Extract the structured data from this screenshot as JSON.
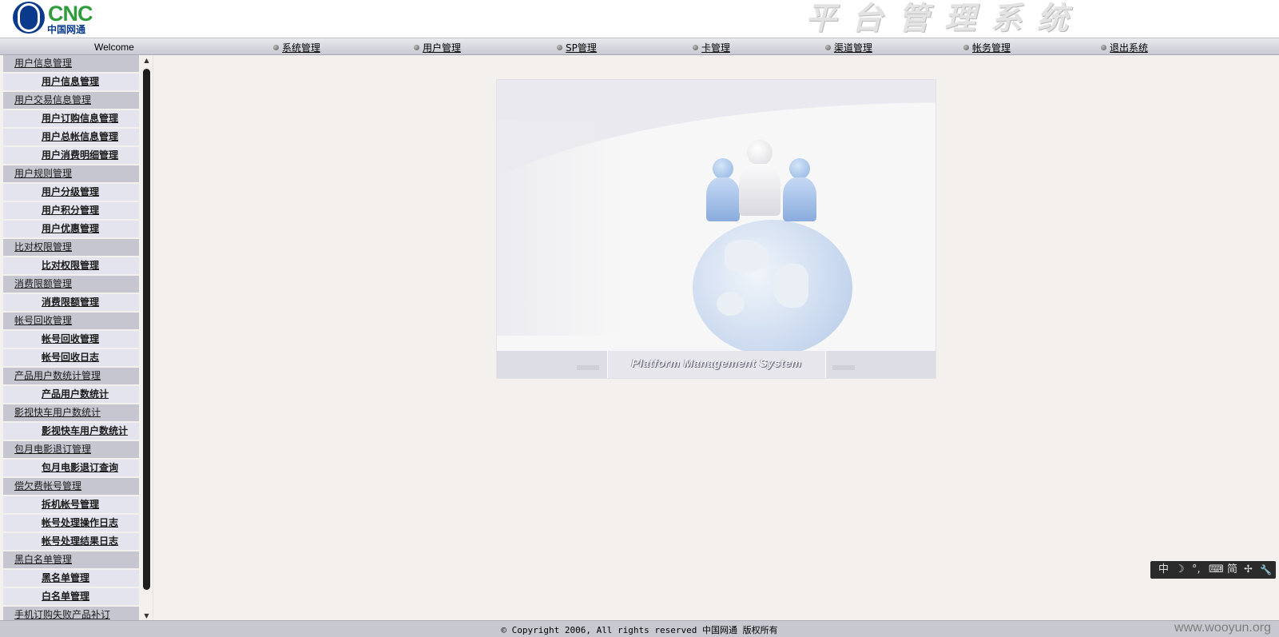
{
  "header": {
    "logo_text": "CNC",
    "logo_subtitle": "中国网通",
    "system_title": "平台管理系统"
  },
  "nav": {
    "welcome": "Welcome",
    "items": [
      {
        "label": "系统管理"
      },
      {
        "label": "用户管理"
      },
      {
        "label": "SP管理"
      },
      {
        "label": "卡管理"
      },
      {
        "label": "渠道管理"
      },
      {
        "label": "帐务管理"
      },
      {
        "label": "退出系统"
      }
    ]
  },
  "sidebar": {
    "items": [
      {
        "label": "用户信息管理",
        "type": "group"
      },
      {
        "label": "用户信息管理",
        "type": "sub"
      },
      {
        "label": "用户交易信息管理",
        "type": "group"
      },
      {
        "label": "用户订购信息管理",
        "type": "sub"
      },
      {
        "label": "用户总帐信息管理",
        "type": "sub"
      },
      {
        "label": "用户消费明细管理",
        "type": "sub"
      },
      {
        "label": "用户规则管理",
        "type": "group"
      },
      {
        "label": "用户分级管理",
        "type": "sub"
      },
      {
        "label": "用户积分管理",
        "type": "sub"
      },
      {
        "label": "用户优惠管理",
        "type": "sub"
      },
      {
        "label": "比对权限管理",
        "type": "group"
      },
      {
        "label": "比对权限管理",
        "type": "sub"
      },
      {
        "label": "消费限额管理",
        "type": "group"
      },
      {
        "label": "消费限额管理",
        "type": "sub"
      },
      {
        "label": "帐号回收管理",
        "type": "group"
      },
      {
        "label": "帐号回收管理",
        "type": "sub"
      },
      {
        "label": "帐号回收日志",
        "type": "sub"
      },
      {
        "label": "产品用户数统计管理",
        "type": "group"
      },
      {
        "label": "产品用户数统计",
        "type": "sub"
      },
      {
        "label": "影视快车用户数统计",
        "type": "group"
      },
      {
        "label": "影视快车用户数统计",
        "type": "sub"
      },
      {
        "label": "包月电影退订管理",
        "type": "group"
      },
      {
        "label": "包月电影退订查询",
        "type": "sub"
      },
      {
        "label": "偿欠费帐号管理",
        "type": "group"
      },
      {
        "label": "拆机帐号管理",
        "type": "sub"
      },
      {
        "label": "帐号处理操作日志",
        "type": "sub"
      },
      {
        "label": "帐号处理结果日志",
        "type": "sub"
      },
      {
        "label": "黑白名单管理",
        "type": "group"
      },
      {
        "label": "黑名单管理",
        "type": "sub"
      },
      {
        "label": "白名单管理",
        "type": "sub"
      },
      {
        "label": "手机订购失败产品补订",
        "type": "group"
      }
    ]
  },
  "banner": {
    "caption": "Platform Management System"
  },
  "ime": {
    "buttons": [
      "中",
      "☽",
      "°,",
      "⌨",
      "简",
      "✢",
      "🔧"
    ]
  },
  "footer": {
    "copyright": "© Copyright 2006, All rights reserved 中国网通 版权所有",
    "watermark": "www.wooyun.org"
  }
}
